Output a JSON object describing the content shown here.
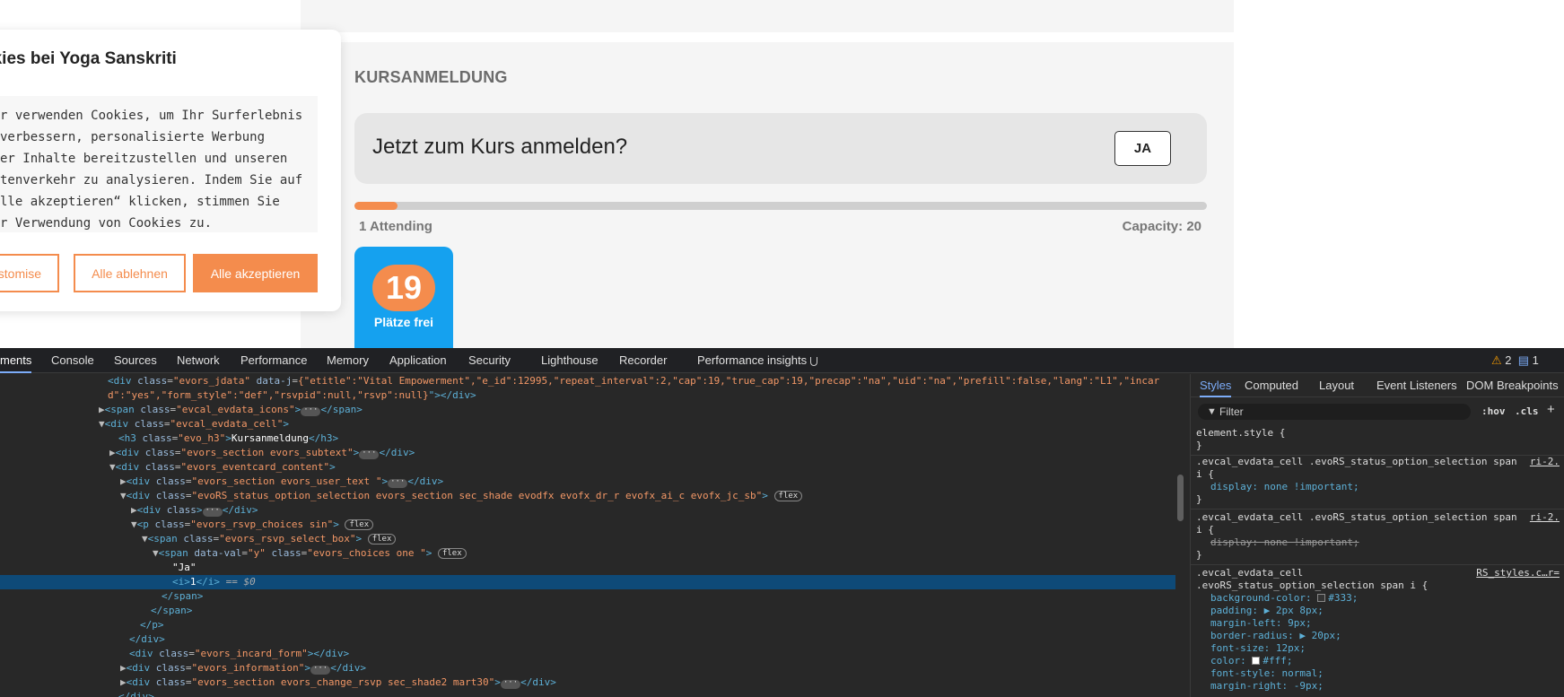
{
  "page": {
    "section_title": "KURSANMELDUNG",
    "rsvp_question": "Jetzt zum Kurs anmelden?",
    "ja_button": "JA",
    "attending": "1 Attending",
    "capacity": "Capacity: 20",
    "attendance_fraction": 0.05,
    "seats_number": "19",
    "seats_label": "Plätze frei",
    "accent_color": "#f48c4d",
    "seats_card_color": "#15a1ef"
  },
  "cookie": {
    "title": "okies bei Yoga Sanskriti",
    "text_lines": [
      "r verwenden Cookies, um Ihr Surferlebnis",
      " verbessern, personalisierte Werbung",
      "er Inhalte bereitzustellen und unseren",
      "tenverkehr zu analysieren. Indem Sie auf",
      "lle akzeptieren“ klicken, stimmen Sie",
      "r Verwendung von Cookies zu."
    ],
    "customise": "ustomise",
    "reject_all": "Alle ablehnen",
    "accept_all": "Alle akzeptieren"
  },
  "devtools": {
    "tabs": [
      "ments",
      "Console",
      "Sources",
      "Network",
      "Performance",
      "Memory",
      "Application",
      "Security",
      "Lighthouse",
      "Recorder",
      "Performance insights"
    ],
    "warnings": "2",
    "messages": "1",
    "elements": {
      "l1_tag": "div",
      "l1_attr1": "class",
      "l1_val1": "evors_jdata",
      "l1_attr2": "data-j",
      "l1_json": "{\"etitle\":\"Vital Empowerment\",\"e_id\":12995,\"repeat_interval\":2,\"cap\":19,\"true_cap\":19,\"precap\":\"na\",\"uid\":\"na\",\"prefill\":false,\"lang\":\"L1\",\"incar",
      "l2_json": "d\":\"yes\",\"form_style\":\"def\",\"rsvpid\":null,\"rsvp\":null}",
      "l3_val": "evcal_evdata_icons",
      "l4_val": "evcal_evdata_cell",
      "l5_val": "evo_h3",
      "l5_text": "Kursanmeldung",
      "l6_val": "evors_section evors_subtext",
      "l7_val": "evors_eventcard_content",
      "l8_val": "evors_section evors_user_text ",
      "l9_val": "evoRS_status_option_selection evors_section sec_shade evodfx evofx_dr_r evofx_ai_c evofx_jc_sb",
      "l11_val": "evors_rsvp_choices sin",
      "l12_val": "evors_rsvp_select_box",
      "l13_dv": "y",
      "l13_val": "evors_choices one ",
      "l14_text": "\"Ja\"",
      "l15_text": "1",
      "l15_eq": "== $0",
      "l20_val": "evors_incard_form",
      "l21_val": "evors_information",
      "l22_val": "evors_section evors_change_rsvp sec_shade2 mart30",
      "flex": "flex",
      "ell": "···"
    },
    "styles": {
      "tabs": [
        "Styles",
        "Computed",
        "Layout",
        "Event Listeners",
        "DOM Breakpoints"
      ],
      "filter_placeholder": "Filter",
      "hov": ":hov",
      "cls": ".cls",
      "element_style": "element.style {",
      "close": "}",
      "rule1_sel1": ".evcal_evdata_cell .evoRS_status_option_selection span",
      "rule1_sel2": "i {",
      "rule1_src": "ri-2.",
      "rule1_prop": "display: none !important;",
      "rule2_sel1": ".evcal_evdata_cell .evoRS_status_option_selection span",
      "rule2_sel2": "i {",
      "rule2_src": "ri-2.",
      "rule2_prop": "display: none !important;",
      "rule3_sel1": ".evcal_evdata_cell",
      "rule3_sel2": ".evoRS_status_option_selection span i {",
      "rule3_src": "RS_styles.c…r=",
      "rule3_props": [
        "background-color: ",
        "padding: ▶ 2px 8px;",
        "margin-left: 9px;",
        "border-radius: ▶ 20px;",
        "font-size: 12px;",
        "color: ",
        "font-style: normal;",
        "margin-right: -9px;"
      ],
      "bg_value": "#333;",
      "color_value": "#fff;"
    }
  }
}
